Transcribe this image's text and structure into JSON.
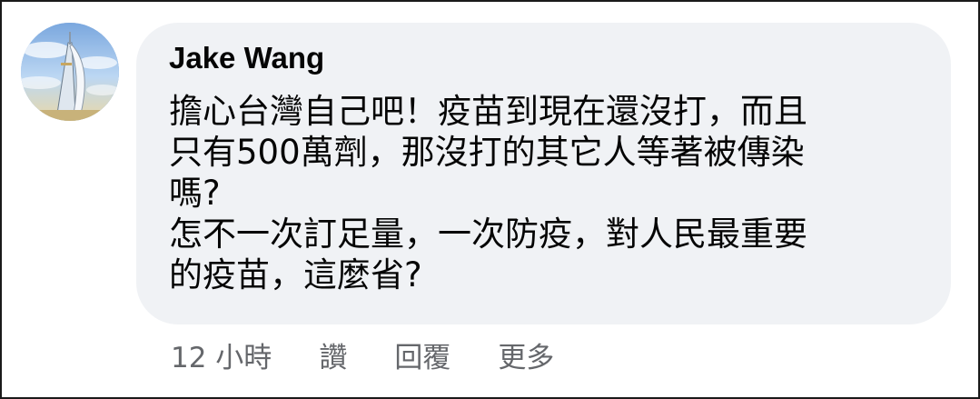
{
  "comment": {
    "author": "Jake Wang",
    "body_lines": [
      "擔心台灣自己吧！疫苗到現在還沒打，而且",
      "只有500萬劑，那沒打的其它人等著被傳染",
      "嗎?",
      "怎不一次訂足量，一次防疫，對人民最重要",
      "的疫苗，這麼省?"
    ],
    "timestamp": "12 小時",
    "actions": {
      "like": "讚",
      "reply": "回覆",
      "more": "更多"
    }
  },
  "avatar": {
    "icon": "burj-al-arab-photo"
  },
  "colors": {
    "bubble": "#f0f2f5",
    "text": "#050505",
    "secondary_text": "#65676b",
    "frame_border": "#1a1a1a"
  }
}
